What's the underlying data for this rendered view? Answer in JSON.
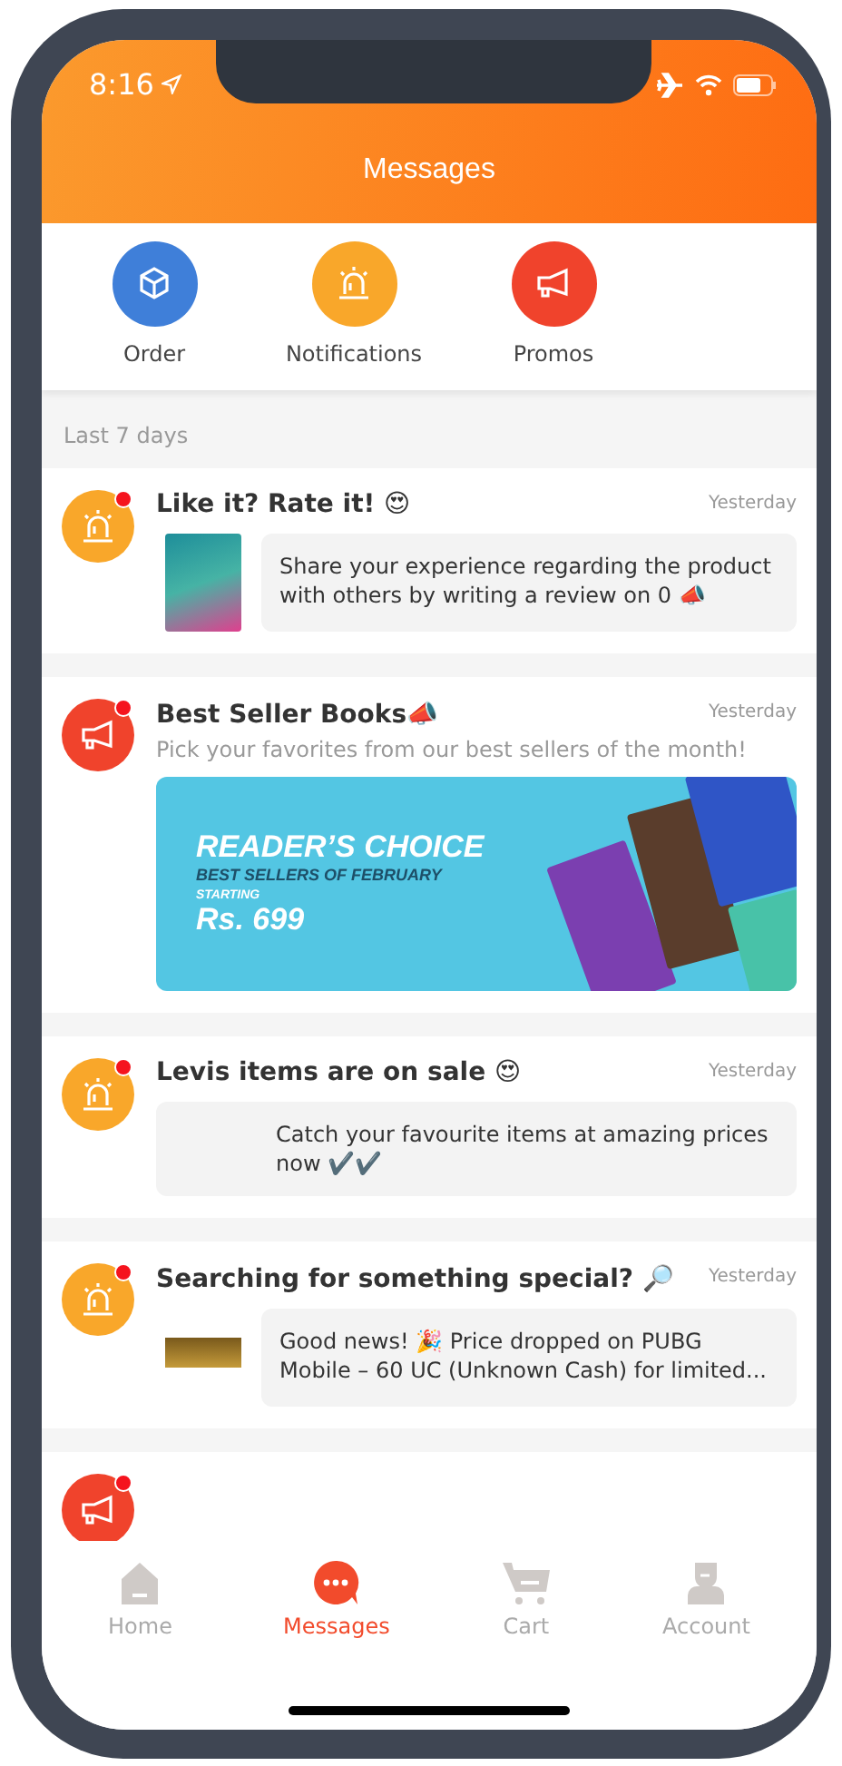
{
  "status_bar": {
    "time": "8:16"
  },
  "header": {
    "title": "Messages"
  },
  "categories": [
    {
      "label": "Order",
      "kind": "order",
      "color": "#3f7fd9"
    },
    {
      "label": "Notifications",
      "kind": "alarm",
      "color": "#f9a72a"
    },
    {
      "label": "Promos",
      "kind": "megaphone",
      "color": "#f0432c"
    }
  ],
  "section": {
    "title": "Last 7 days"
  },
  "messages": [
    {
      "kind": "alert_thumb",
      "unread": true,
      "title": "Like it? Rate it! 😍",
      "time": "Yesterday",
      "body": "Share your experience regarding the product with others by writing a review on 0 📣"
    },
    {
      "kind": "promo_banner",
      "unread": true,
      "title": "Best Seller Books📣",
      "time": "Yesterday",
      "body": "Pick your favorites from our best sellers of the month!",
      "banner": {
        "headline": "READER’S CHOICE",
        "subline": "BEST SELLERS OF FEBRUARY",
        "price_label": "STARTING",
        "price": "Rs. 699"
      }
    },
    {
      "kind": "alert_bubble",
      "unread": true,
      "title": "Levis items are on sale 😍",
      "time": "Yesterday",
      "body": "Catch your favourite items at amazing prices now ✔️✔️"
    },
    {
      "kind": "alert_thumb",
      "unread": true,
      "title": "Searching for something special? 🔎",
      "time": "Yesterday",
      "body": "Good news! 🎉 Price dropped on PUBG Mobile – 60 UC (Unknown Cash) for limited..."
    },
    {
      "kind": "promo_partial",
      "unread": true
    }
  ],
  "tab_bar": [
    {
      "label": "Home",
      "kind": "home",
      "selected": false
    },
    {
      "label": "Messages",
      "kind": "chat",
      "selected": true
    },
    {
      "label": "Cart",
      "kind": "cart",
      "selected": false
    },
    {
      "label": "Account",
      "kind": "account",
      "selected": false
    }
  ]
}
